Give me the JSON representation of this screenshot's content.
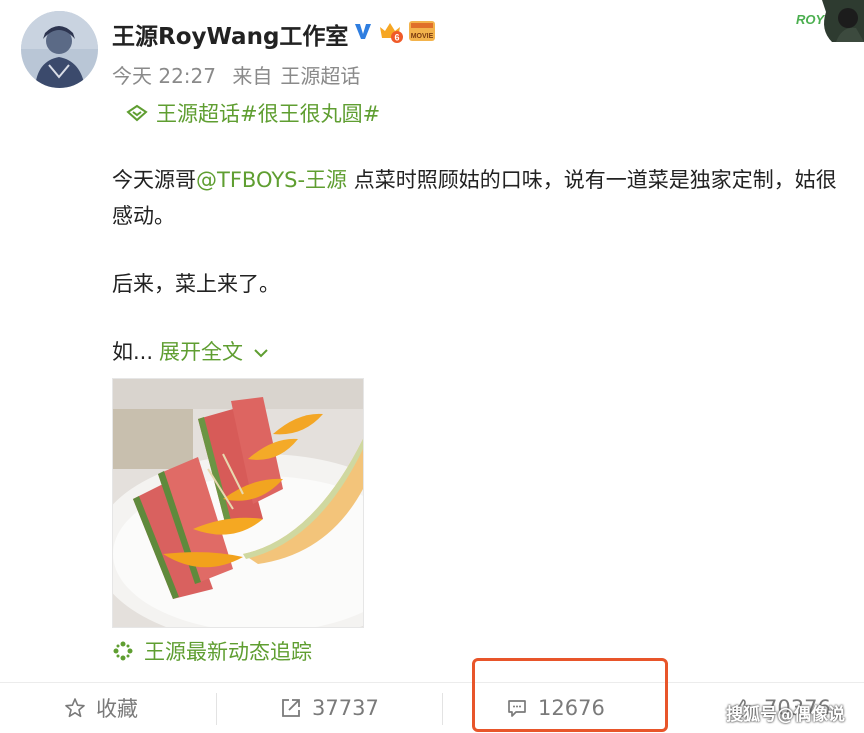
{
  "post": {
    "username": "王源RoyWang工作室",
    "timestamp": "今天 22:27",
    "source_prefix": "来自",
    "source": "王源超话",
    "topic": "王源超话#很王很丸圆#",
    "body_part1": "今天源哥",
    "mention": "@TFBOYS-王源",
    "body_part2": " 点菜时照顾姑的口味，说有一道菜是独家定制，姑很感动。",
    "body_para2": "后来，菜上来了。",
    "truncated_text": "如...",
    "expand_label": "展开全文",
    "tracker_label": "王源最新动态追踪",
    "corner_text": "ROY"
  },
  "badges": {
    "verified": "V",
    "movie": "MOVIE"
  },
  "actions": {
    "favorite_label": "收藏",
    "repost_count": "37737",
    "comment_count": "12676",
    "like_count": "70376"
  },
  "watermark": "搜狐号@偶像说",
  "colors": {
    "link_green": "#5f9e31",
    "meta_gray": "#8a8a8a",
    "highlight_red": "#e8552a",
    "verified_blue": "#2f7ee0"
  }
}
